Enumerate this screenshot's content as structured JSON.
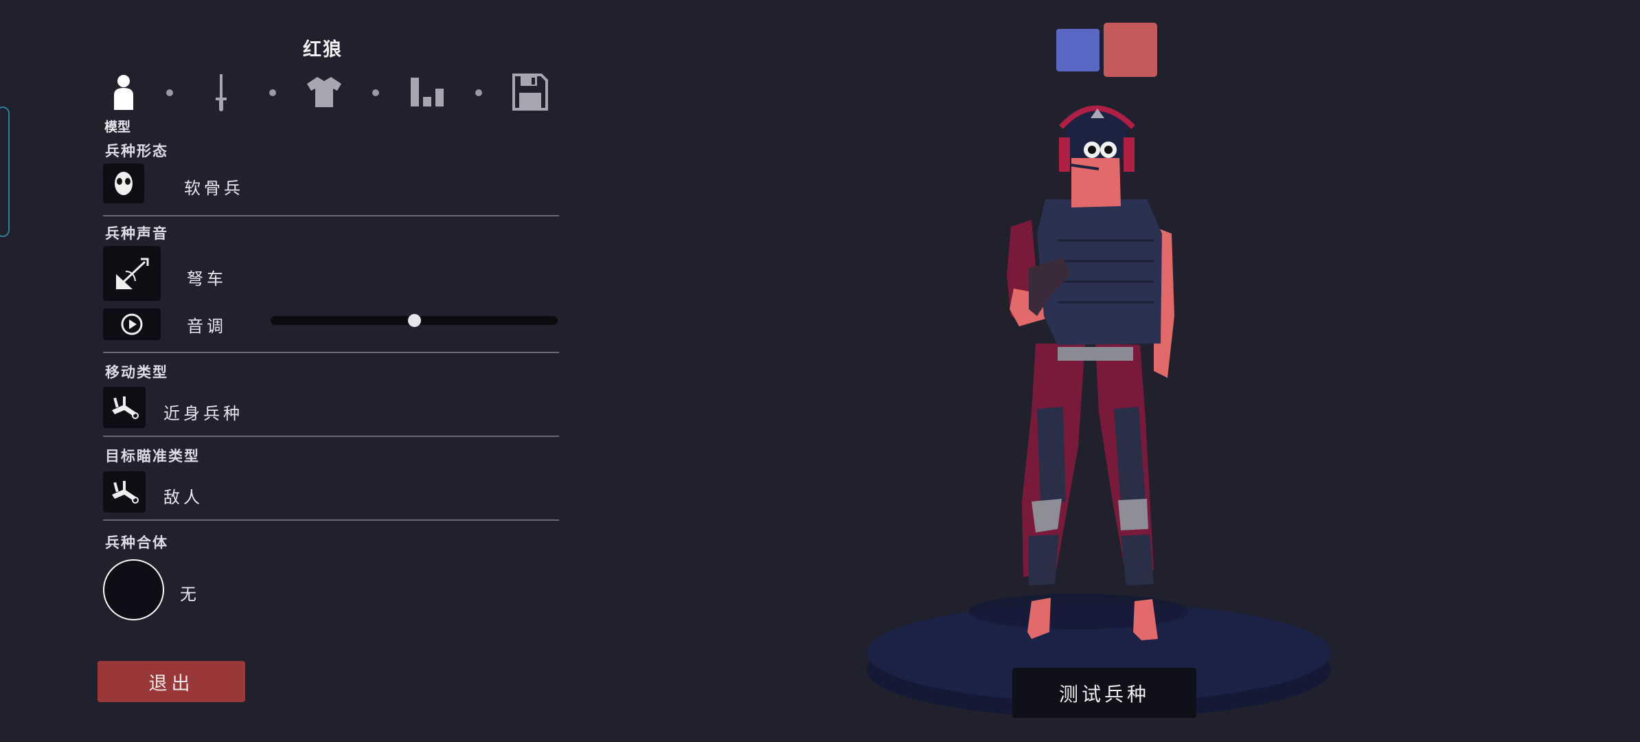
{
  "unit": {
    "name": "红狼"
  },
  "tabs": {
    "active_caption": "模型",
    "items": [
      {
        "icon": "person-icon",
        "active": true
      },
      {
        "icon": "sword-icon",
        "active": false
      },
      {
        "icon": "shirt-icon",
        "active": false
      },
      {
        "icon": "stats-icon",
        "active": false
      },
      {
        "icon": "save-icon",
        "active": false
      }
    ]
  },
  "sections": {
    "body_type": {
      "title": "兵种形态",
      "value": "软骨兵",
      "icon": "skull-mask-icon"
    },
    "voice": {
      "title": "兵种声音",
      "value": "弩车",
      "icon": "ballista-icon",
      "pitch_label": "音调",
      "pitch_value": 0.5,
      "play_icon": "play-icon"
    },
    "movement": {
      "title": "移动类型",
      "value": "近身兵种",
      "icon": "fallen-unit-icon"
    },
    "targeting": {
      "title": "目标瞄准类型",
      "value": "敌人",
      "icon": "fallen-unit-icon"
    },
    "combine": {
      "title": "兵种合体",
      "value": "无"
    }
  },
  "buttons": {
    "exit": "退出",
    "test_unit": "测试兵种"
  },
  "team_colors": {
    "blue": "#5a68c4",
    "red": "#c55a5a",
    "selected": "red"
  }
}
